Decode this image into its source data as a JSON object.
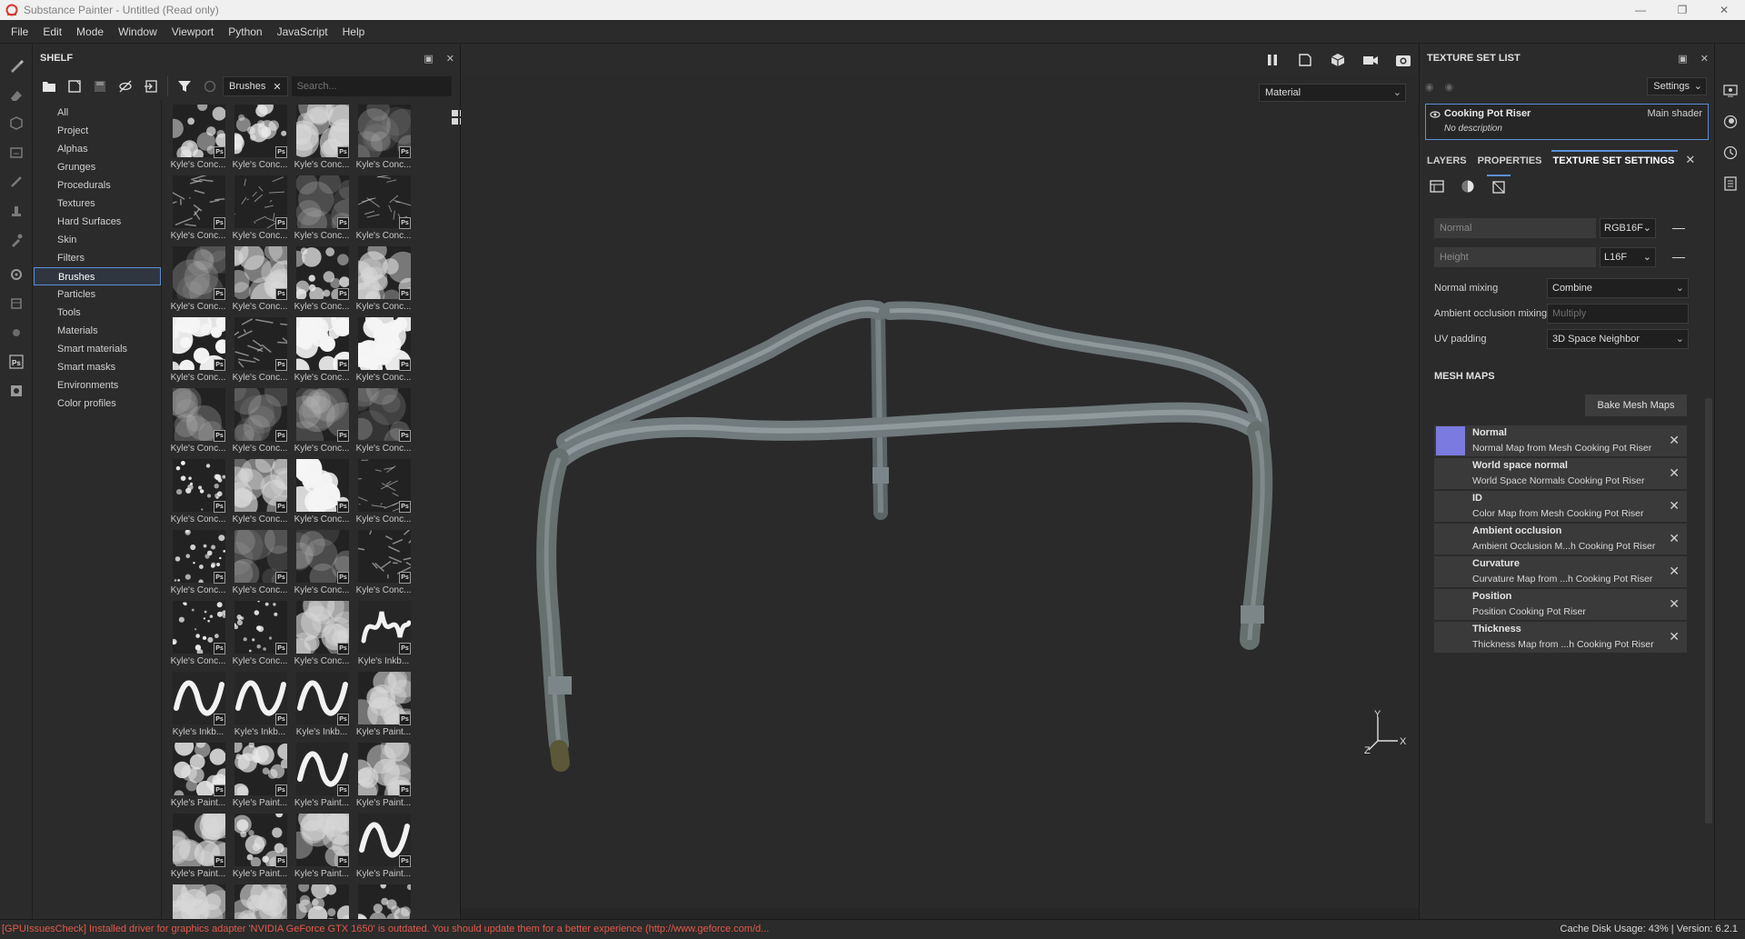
{
  "window": {
    "title": "Substance Painter - Untitled (Read only)",
    "controls": [
      "minimize-icon",
      "maximize-icon",
      "close-icon"
    ]
  },
  "menu": [
    "File",
    "Edit",
    "Mode",
    "Window",
    "Viewport",
    "Python",
    "JavaScript",
    "Help"
  ],
  "shelf": {
    "title": "SHELF",
    "filter_tag": "Brushes",
    "search_placeholder": "Search...",
    "categories": [
      "All",
      "Project",
      "Alphas",
      "Grunges",
      "Procedurals",
      "Textures",
      "Hard Surfaces",
      "Skin",
      "Filters",
      "Brushes",
      "Particles",
      "Tools",
      "Materials",
      "Smart materials",
      "Smart masks",
      "Environments",
      "Color profiles"
    ],
    "active_category": "Brushes",
    "badge_text": "Ps",
    "items": [
      {
        "label": "Kyle's Conc...",
        "style": "splat"
      },
      {
        "label": "Kyle's Conc...",
        "style": "splat"
      },
      {
        "label": "Kyle's Conc...",
        "style": "cloud"
      },
      {
        "label": "Kyle's Conc...",
        "style": "faint"
      },
      {
        "label": "Kyle's Conc...",
        "style": "streak"
      },
      {
        "label": "Kyle's Conc...",
        "style": "crack"
      },
      {
        "label": "Kyle's Conc...",
        "style": "faint"
      },
      {
        "label": "Kyle's Conc...",
        "style": "crack"
      },
      {
        "label": "Kyle's Conc...",
        "style": "faint"
      },
      {
        "label": "Kyle's Conc...",
        "style": "cloud"
      },
      {
        "label": "Kyle's Conc...",
        "style": "splat"
      },
      {
        "label": "Kyle's Conc...",
        "style": "cloud"
      },
      {
        "label": "Kyle's Conc...",
        "style": "white"
      },
      {
        "label": "Kyle's Conc...",
        "style": "streak"
      },
      {
        "label": "Kyle's Conc...",
        "style": "white"
      },
      {
        "label": "Kyle's Conc...",
        "style": "white"
      },
      {
        "label": "Kyle's Conc...",
        "style": "faint"
      },
      {
        "label": "Kyle's Conc...",
        "style": "faint"
      },
      {
        "label": "Kyle's Conc...",
        "style": "faint"
      },
      {
        "label": "Kyle's Conc...",
        "style": "faint"
      },
      {
        "label": "Kyle's Conc...",
        "style": "dots"
      },
      {
        "label": "Kyle's Conc...",
        "style": "cloud"
      },
      {
        "label": "Kyle's Conc...",
        "style": "white"
      },
      {
        "label": "Kyle's Conc...",
        "style": "crack"
      },
      {
        "label": "Kyle's Conc...",
        "style": "dots"
      },
      {
        "label": "Kyle's Conc...",
        "style": "faint"
      },
      {
        "label": "Kyle's Conc...",
        "style": "faint"
      },
      {
        "label": "Kyle's Conc...",
        "style": "streak"
      },
      {
        "label": "Kyle's Conc...",
        "style": "dots"
      },
      {
        "label": "Kyle's Conc...",
        "style": "dots"
      },
      {
        "label": "Kyle's Conc...",
        "style": "cloud"
      },
      {
        "label": "Kyle's Inkb...",
        "style": "scribble"
      },
      {
        "label": "Kyle's Inkb...",
        "style": "wave"
      },
      {
        "label": "Kyle's Inkb...",
        "style": "wave"
      },
      {
        "label": "Kyle's Inkb...",
        "style": "wave"
      },
      {
        "label": "Kyle's Paint...",
        "style": "cloud"
      },
      {
        "label": "Kyle's Paint...",
        "style": "splat"
      },
      {
        "label": "Kyle's Paint...",
        "style": "splat"
      },
      {
        "label": "Kyle's Paint...",
        "style": "wave"
      },
      {
        "label": "Kyle's Paint...",
        "style": "cloud"
      },
      {
        "label": "Kyle's Paint...",
        "style": "cloud"
      },
      {
        "label": "Kyle's Paint...",
        "style": "splat"
      },
      {
        "label": "Kyle's Paint...",
        "style": "cloud"
      },
      {
        "label": "Kyle's Paint...",
        "style": "wave"
      },
      {
        "label": "",
        "style": "cloud"
      },
      {
        "label": "",
        "style": "cloud"
      },
      {
        "label": "",
        "style": "splat"
      },
      {
        "label": "",
        "style": "splat"
      }
    ]
  },
  "viewport": {
    "view_mode": "Material",
    "axis_labels": {
      "y": "Y",
      "x": "X",
      "z": "Z"
    }
  },
  "texture_set_list": {
    "title": "TEXTURE SET LIST",
    "settings_label": "Settings",
    "entry": {
      "name": "Cooking Pot Riser",
      "shader": "Main shader",
      "description": "No description"
    }
  },
  "tabs": {
    "items": [
      "LAYERS",
      "PROPERTIES",
      "TEXTURE SET SETTINGS"
    ],
    "active": "TEXTURE SET SETTINGS",
    "close_glyph": "✕"
  },
  "texture_set_settings": {
    "channels": [
      {
        "name": "Normal",
        "format": "RGB16F"
      },
      {
        "name": "Height",
        "format": "L16F"
      }
    ],
    "normal_mixing": {
      "label": "Normal mixing",
      "value": "Combine"
    },
    "ao_mixing": {
      "label": "Ambient occlusion mixing",
      "value": "Multiply"
    },
    "uv_padding": {
      "label": "UV padding",
      "value": "3D Space Neighbor"
    },
    "mesh_maps_title": "MESH MAPS",
    "bake_label": "Bake Mesh Maps",
    "mesh_maps": [
      {
        "title": "Normal",
        "subtitle": "Normal Map from Mesh Cooking Pot Riser",
        "has_thumb": true
      },
      {
        "title": "World space normal",
        "subtitle": "World Space Normals Cooking Pot Riser",
        "has_thumb": false
      },
      {
        "title": "ID",
        "subtitle": "Color Map from Mesh Cooking Pot Riser",
        "has_thumb": false
      },
      {
        "title": "Ambient occlusion",
        "subtitle": "Ambient Occlusion M...h Cooking Pot Riser",
        "has_thumb": false
      },
      {
        "title": "Curvature",
        "subtitle": "Curvature Map from ...h Cooking Pot Riser",
        "has_thumb": false
      },
      {
        "title": "Position",
        "subtitle": "Position Cooking Pot Riser",
        "has_thumb": false
      },
      {
        "title": "Thickness",
        "subtitle": "Thickness Map from ...h Cooking Pot Riser",
        "has_thumb": false
      }
    ]
  },
  "status": {
    "message": "[GPUIssuesCheck] Installed driver for graphics adapter 'NVIDIA GeForce GTX 1650' is outdated. You should update them for a better experience (http://www.geforce.com/d...",
    "right": "Cache Disk Usage:    43% | Version: 6.2.1"
  },
  "colors": {
    "accent": "#5b8fd6",
    "error_text": "#e25a4a",
    "panel_bg": "#2b2b2b"
  }
}
